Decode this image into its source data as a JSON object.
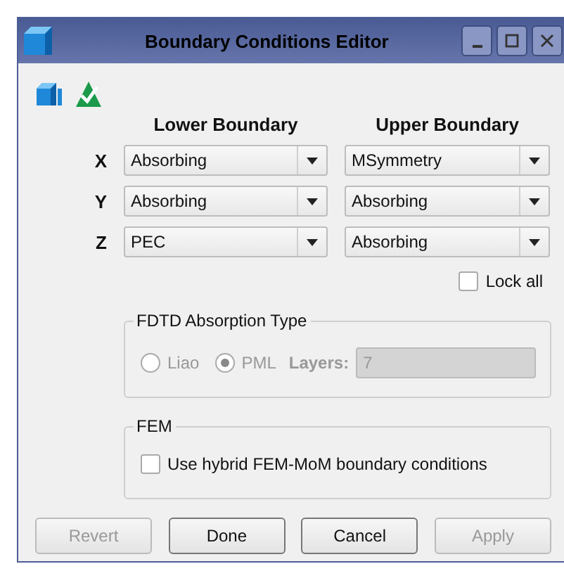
{
  "window": {
    "title": "Boundary Conditions Editor"
  },
  "columns": [
    "Lower Boundary",
    "Upper Boundary"
  ],
  "rows": [
    {
      "axis": "X",
      "lower": "Absorbing",
      "upper": "MSymmetry"
    },
    {
      "axis": "Y",
      "lower": "Absorbing",
      "upper": "Absorbing"
    },
    {
      "axis": "Z",
      "lower": "PEC",
      "upper": "Absorbing"
    }
  ],
  "lock_all": {
    "label": "Lock all",
    "checked": false
  },
  "fdtd": {
    "title": "FDTD Absorption Type",
    "disabled": true,
    "options": [
      {
        "label": "Liao",
        "selected": false
      },
      {
        "label": "PML",
        "selected": true
      }
    ],
    "layers_label": "Layers:",
    "layers_value": "7"
  },
  "fem": {
    "title": "FEM",
    "label": "Use hybrid FEM-MoM boundary conditions",
    "checked": false
  },
  "buttons": [
    {
      "label": "Revert",
      "disabled": true
    },
    {
      "label": "Done",
      "disabled": false
    },
    {
      "label": "Cancel",
      "disabled": false
    },
    {
      "label": "Apply",
      "disabled": true
    }
  ]
}
